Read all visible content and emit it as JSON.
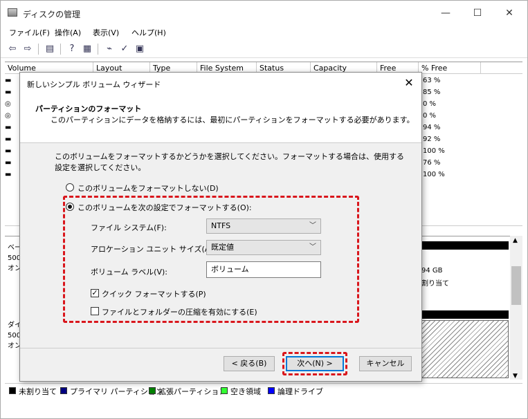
{
  "window": {
    "title": "ディスクの管理",
    "controls": {
      "minimize": "—",
      "maximize": "☐",
      "close": "✕"
    }
  },
  "menu": [
    "ファイル(F)",
    "操作(A)",
    "表示(V)",
    "ヘルプ(H)"
  ],
  "columns": [
    "Volume",
    "Layout",
    "Type",
    "File System",
    "Status",
    "Capacity",
    "Free Spa...",
    "% Free"
  ],
  "percent_free": [
    "63 %",
    "85 %",
    "0 %",
    "0 %",
    "94 %",
    "92 %",
    "100 %",
    "76 %",
    "100 %"
  ],
  "disks": [
    {
      "lines": [
        "ベー",
        "500",
        "オン"
      ]
    },
    {
      "lines": [
        "ダイ",
        "500",
        "オン"
      ]
    }
  ],
  "disk_right_text": [
    "94 GB",
    "割り当て"
  ],
  "legend": [
    {
      "label": "未割り当て",
      "color": "#000000"
    },
    {
      "label": "プライマリ パーティション",
      "color": "#000080"
    },
    {
      "label": "拡張パーティション",
      "color": "#008000"
    },
    {
      "label": "空き領域",
      "color": "#33ff33"
    },
    {
      "label": "論理ドライブ",
      "color": "#0000ff"
    }
  ],
  "dialog": {
    "title": "新しいシンプル ボリューム ウィザード",
    "close": "✕",
    "header_title": "パーティションのフォーマット",
    "header_sub": "このパーティションにデータを格納するには、最初にパーティションをフォーマットする必要があります。",
    "description": "このボリュームをフォーマットするかどうかを選択してください。フォーマットする場合は、使用する設定を選択してください。",
    "radio_no_format": "このボリュームをフォーマットしない(D)",
    "radio_format": "このボリュームを次の設定でフォーマットする(O):",
    "fs_label": "ファイル システム(F):",
    "fs_value": "NTFS",
    "alloc_label": "アロケーション ユニット サイズ(A):",
    "alloc_value": "既定値",
    "vol_label": "ボリューム ラベル(V):",
    "vol_value": "ボリューム",
    "quick_format": "クイック フォーマットする(P)",
    "compression": "ファイルとフォルダーの圧縮を有効にする(E)",
    "back": "< 戻る(B)",
    "next": "次へ(N) >",
    "cancel": "キャンセル"
  }
}
